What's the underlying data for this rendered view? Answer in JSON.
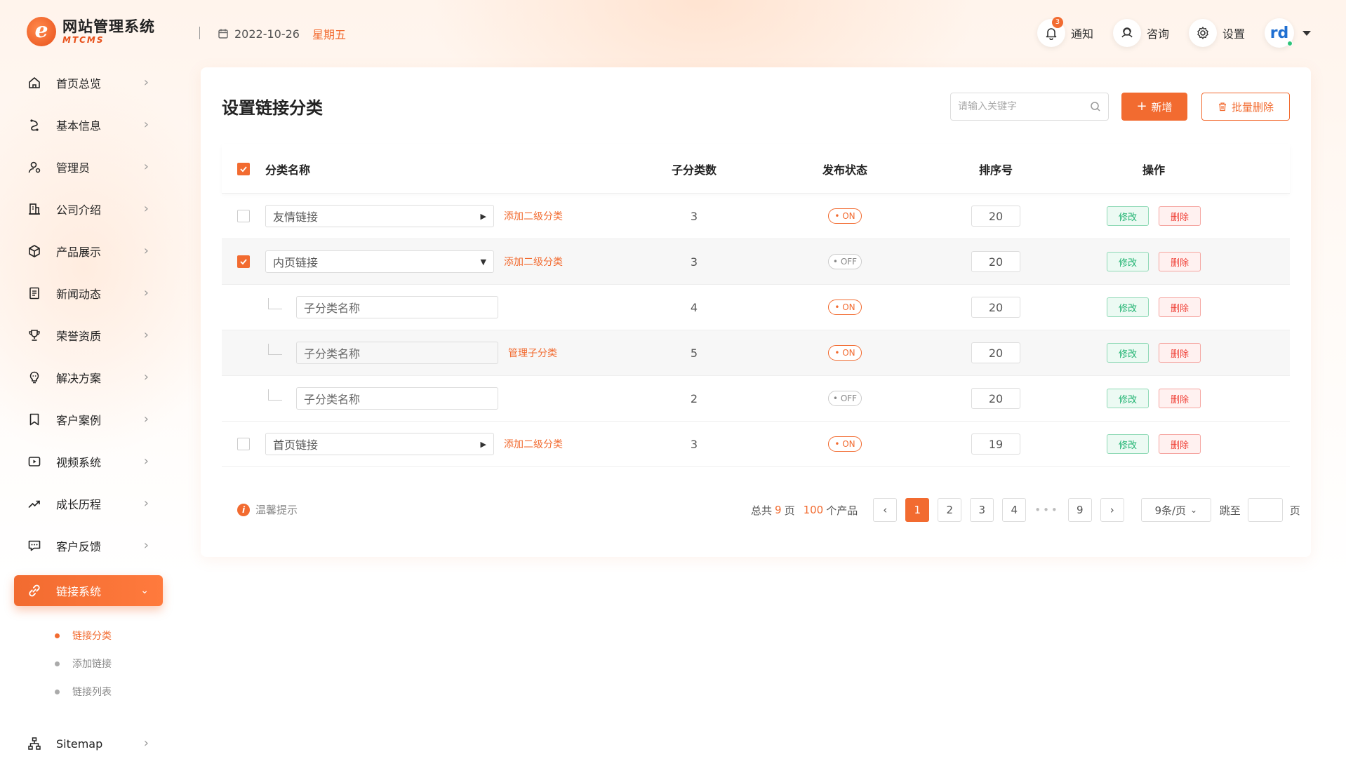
{
  "header": {
    "logo_title": "网站管理系统",
    "logo_sub": "MTCMS",
    "date": "2022-10-26",
    "weekday": "星期五",
    "notify_label": "通知",
    "notify_count": "3",
    "consult_label": "咨询",
    "settings_label": "设置",
    "avatar_text": "rd"
  },
  "sidebar": {
    "items": [
      {
        "label": "首页总览",
        "icon": "home-icon"
      },
      {
        "label": "基本信息",
        "icon": "info-icon"
      },
      {
        "label": "管理员",
        "icon": "user-icon"
      },
      {
        "label": "公司介绍",
        "icon": "building-icon"
      },
      {
        "label": "产品展示",
        "icon": "box-icon"
      },
      {
        "label": "新闻动态",
        "icon": "news-icon"
      },
      {
        "label": "荣誉资质",
        "icon": "trophy-icon"
      },
      {
        "label": "解决方案",
        "icon": "bulb-icon"
      },
      {
        "label": "客户案例",
        "icon": "bookmark-icon"
      },
      {
        "label": "视频系统",
        "icon": "video-icon"
      },
      {
        "label": "成长历程",
        "icon": "trend-icon"
      },
      {
        "label": "客户反馈",
        "icon": "chat-icon"
      },
      {
        "label": "链接系统",
        "icon": "link-icon",
        "active": true
      },
      {
        "label": "Sitemap",
        "icon": "sitemap-icon"
      }
    ],
    "sub_items": [
      {
        "label": "链接分类",
        "active": true
      },
      {
        "label": "添加链接"
      },
      {
        "label": "链接列表"
      }
    ]
  },
  "main": {
    "title": "设置链接分类",
    "search_placeholder": "请输入关键字",
    "add_label": "新增",
    "bulk_delete_label": "批量删除",
    "columns": [
      "分类名称",
      "子分类数",
      "发布状态",
      "排序号",
      "操作"
    ],
    "rows": [
      {
        "name": "友情链接",
        "kind": "parent",
        "expanded": false,
        "checked": false,
        "action": "添加二级分类",
        "sub_count": "3",
        "status": "ON",
        "sort": "20",
        "shaded": false
      },
      {
        "name": "内页链接",
        "kind": "parent",
        "expanded": true,
        "checked": true,
        "action": "添加二级分类",
        "sub_count": "3",
        "status": "OFF",
        "sort": "20",
        "shaded": true
      },
      {
        "name": "子分类名称",
        "kind": "child",
        "action": "",
        "sub_count": "4",
        "status": "ON",
        "sort": "20",
        "shaded": false
      },
      {
        "name": "子分类名称",
        "kind": "child",
        "action": "管理子分类",
        "sub_count": "5",
        "status": "ON",
        "sort": "20",
        "shaded": true
      },
      {
        "name": "子分类名称",
        "kind": "child",
        "action": "",
        "sub_count": "2",
        "status": "OFF",
        "sort": "20",
        "shaded": false
      },
      {
        "name": "首页链接",
        "kind": "parent",
        "expanded": false,
        "checked": false,
        "action": "添加二级分类",
        "sub_count": "3",
        "status": "ON",
        "sort": "19",
        "shaded": false
      }
    ],
    "edit_label": "修改",
    "delete_label": "删除",
    "tip_label": "温馨提示",
    "pagination": {
      "prefix": "总共",
      "total_pages": "9",
      "pages_unit": "页",
      "total_items": "100",
      "items_unit": "个产品",
      "pages": [
        "1",
        "2",
        "3",
        "4"
      ],
      "last_page": "9",
      "current": "1",
      "per_page": "9条/页",
      "jump_label": "跳至",
      "jump_unit": "页"
    }
  },
  "colors": {
    "accent": "#f26b30",
    "edit": "#20b371",
    "delete": "#f0433a"
  }
}
